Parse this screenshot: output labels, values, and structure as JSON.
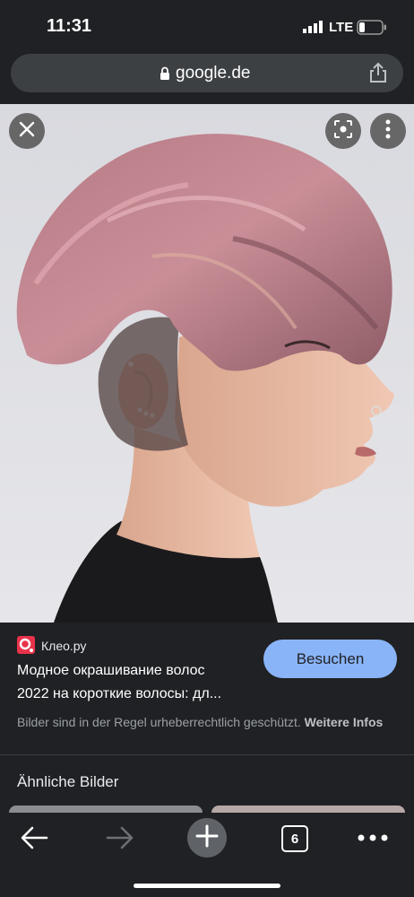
{
  "status_bar": {
    "time": "11:31",
    "network": "LTE",
    "icons": [
      "signal-icon",
      "battery-icon"
    ]
  },
  "url_bar": {
    "domain": "google.de",
    "icons": [
      "lock-icon",
      "share-icon"
    ]
  },
  "image_viewer": {
    "icons": [
      "close-icon",
      "lens-icon",
      "more-vertical-icon"
    ],
    "image_subject": "photo of a woman with a short pink pixie haircut in profile"
  },
  "result": {
    "source_name": "Клео.ру",
    "title_line1": "Модное окрашивание волос",
    "title_line2": "2022 на короткие волосы: дл...",
    "visit_label": "Besuchen",
    "copyright_text": "Bilder sind in der Regel urheberrechtlich geschützt.",
    "more_info_label": "Weitere Infos"
  },
  "related": {
    "heading": "Ähnliche Bilder"
  },
  "bottom_bar": {
    "tab_count": "6",
    "icons": [
      "back-arrow-icon",
      "forward-arrow-icon",
      "plus-icon",
      "tabs-icon",
      "more-horizontal-icon"
    ]
  },
  "colors": {
    "background": "#202124",
    "accent_button": "#8ab4f8",
    "source_logo": "#e8334a",
    "url_bar": "#3c4043"
  }
}
